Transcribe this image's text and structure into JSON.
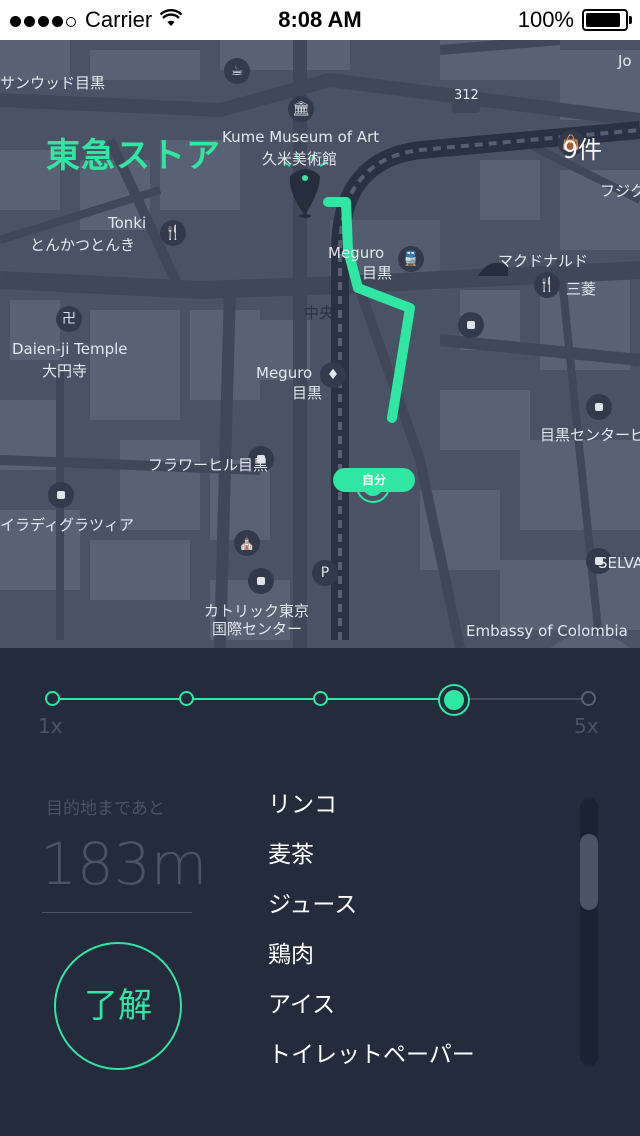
{
  "status_bar": {
    "carrier": "Carrier",
    "time": "8:08 AM",
    "battery": "100%",
    "battery_level": 1.0,
    "signal_bars_filled": 4,
    "signal_bars_total": 5
  },
  "header": {
    "store_name": "東急ストア",
    "count": "9件"
  },
  "map": {
    "labels": {
      "sanwa": "サンウッド目黒",
      "kume_en": "Kume Museum of Art",
      "kume_jp": "久米美術館",
      "tonki_en": "Tonki",
      "tonki_jp": "とんかつとんき",
      "meguro_station_en": "Meguro",
      "meguro_station_jp": "目黒",
      "mcdonalds": "マクドナルド",
      "mitsubishi": "三菱",
      "chuo": "中央",
      "daienji_en": "Daien-ji Temple",
      "daienji_jp": "大円寺",
      "meguro2_en": "Meguro",
      "meguro2_jp": "目黒",
      "center": "目黒センタービ",
      "flower_hill": "フラワーヒル目黒",
      "paradigm": "イラディグラツィア",
      "catholic": "カトリック東京",
      "catholic2": "国際センター",
      "embassy": "Embassy of Colombia",
      "selva": "SELVA",
      "fuji": "フジク",
      "jo": "Jo",
      "route": "312",
      "p": "P",
      "self_badge": "自分"
    },
    "accent_color": "#2fe6a3"
  },
  "speed_slider": {
    "min_label": "1x",
    "max_label": "5x",
    "stops_total": 5,
    "selected_index": 3
  },
  "distance": {
    "label": "目的地まであと",
    "value": "183m"
  },
  "ok_button": "了解",
  "shopping_list": [
    "リンコ",
    "麦茶",
    "ジュース",
    "鶏肉",
    "アイス",
    "トイレットペーパー"
  ],
  "colors": {
    "accent": "#2fe6a3",
    "background": "#232b3d",
    "muted": "#4b5366"
  }
}
